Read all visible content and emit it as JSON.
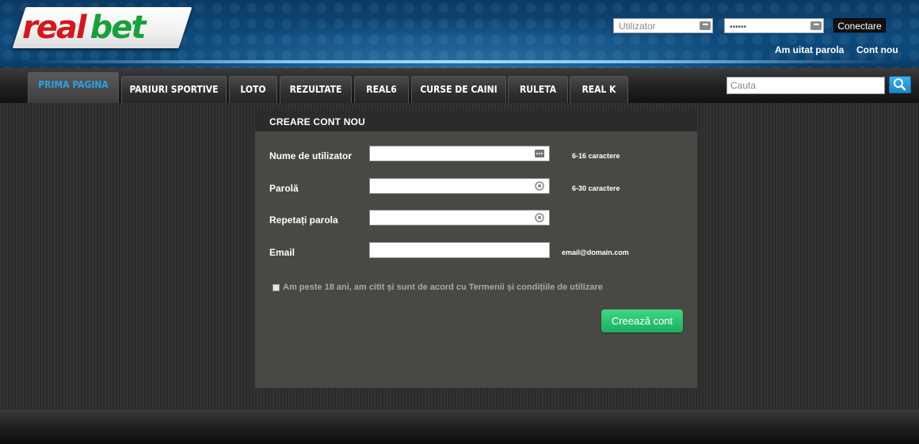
{
  "brand": {
    "logo_real": "real",
    "logo_bet": "bet",
    "real_color": "#d3181c",
    "bet_color": "#16a13a"
  },
  "login": {
    "username_placeholder": "Utilizator",
    "password_value": "••••••",
    "connect_label": "Conectare",
    "forgot_label": "Am uitat parola",
    "new_account_label": "Cont nou"
  },
  "nav": {
    "tabs": [
      {
        "label": "PRIMA PAGINA",
        "active": true
      },
      {
        "label": "PARIURI SPORTIVE",
        "active": false
      },
      {
        "label": "LOTO",
        "active": false
      },
      {
        "label": "REZULTATE",
        "active": false
      },
      {
        "label": "REAL6",
        "active": false
      },
      {
        "label": "CURSE DE CAINI",
        "active": false
      },
      {
        "label": "RULETA",
        "active": false
      },
      {
        "label": "REAL K",
        "active": false
      }
    ],
    "search_placeholder": "Cauta",
    "accent_color": "#27a3e3"
  },
  "form": {
    "title": "CREARE CONT NOU",
    "username_label": "Nume de utilizator",
    "username_hint": "6-16 caractere",
    "password_label": "Parolă",
    "password_hint": "6-30 caractere",
    "repeat_label": "Repetați parola",
    "email_label": "Email",
    "email_hint": "email@domain.com",
    "terms_label": "Am peste 18 ani, am citit și sunt de acord cu Termenii și condițiile de utilizare",
    "create_label": "Creează cont"
  }
}
